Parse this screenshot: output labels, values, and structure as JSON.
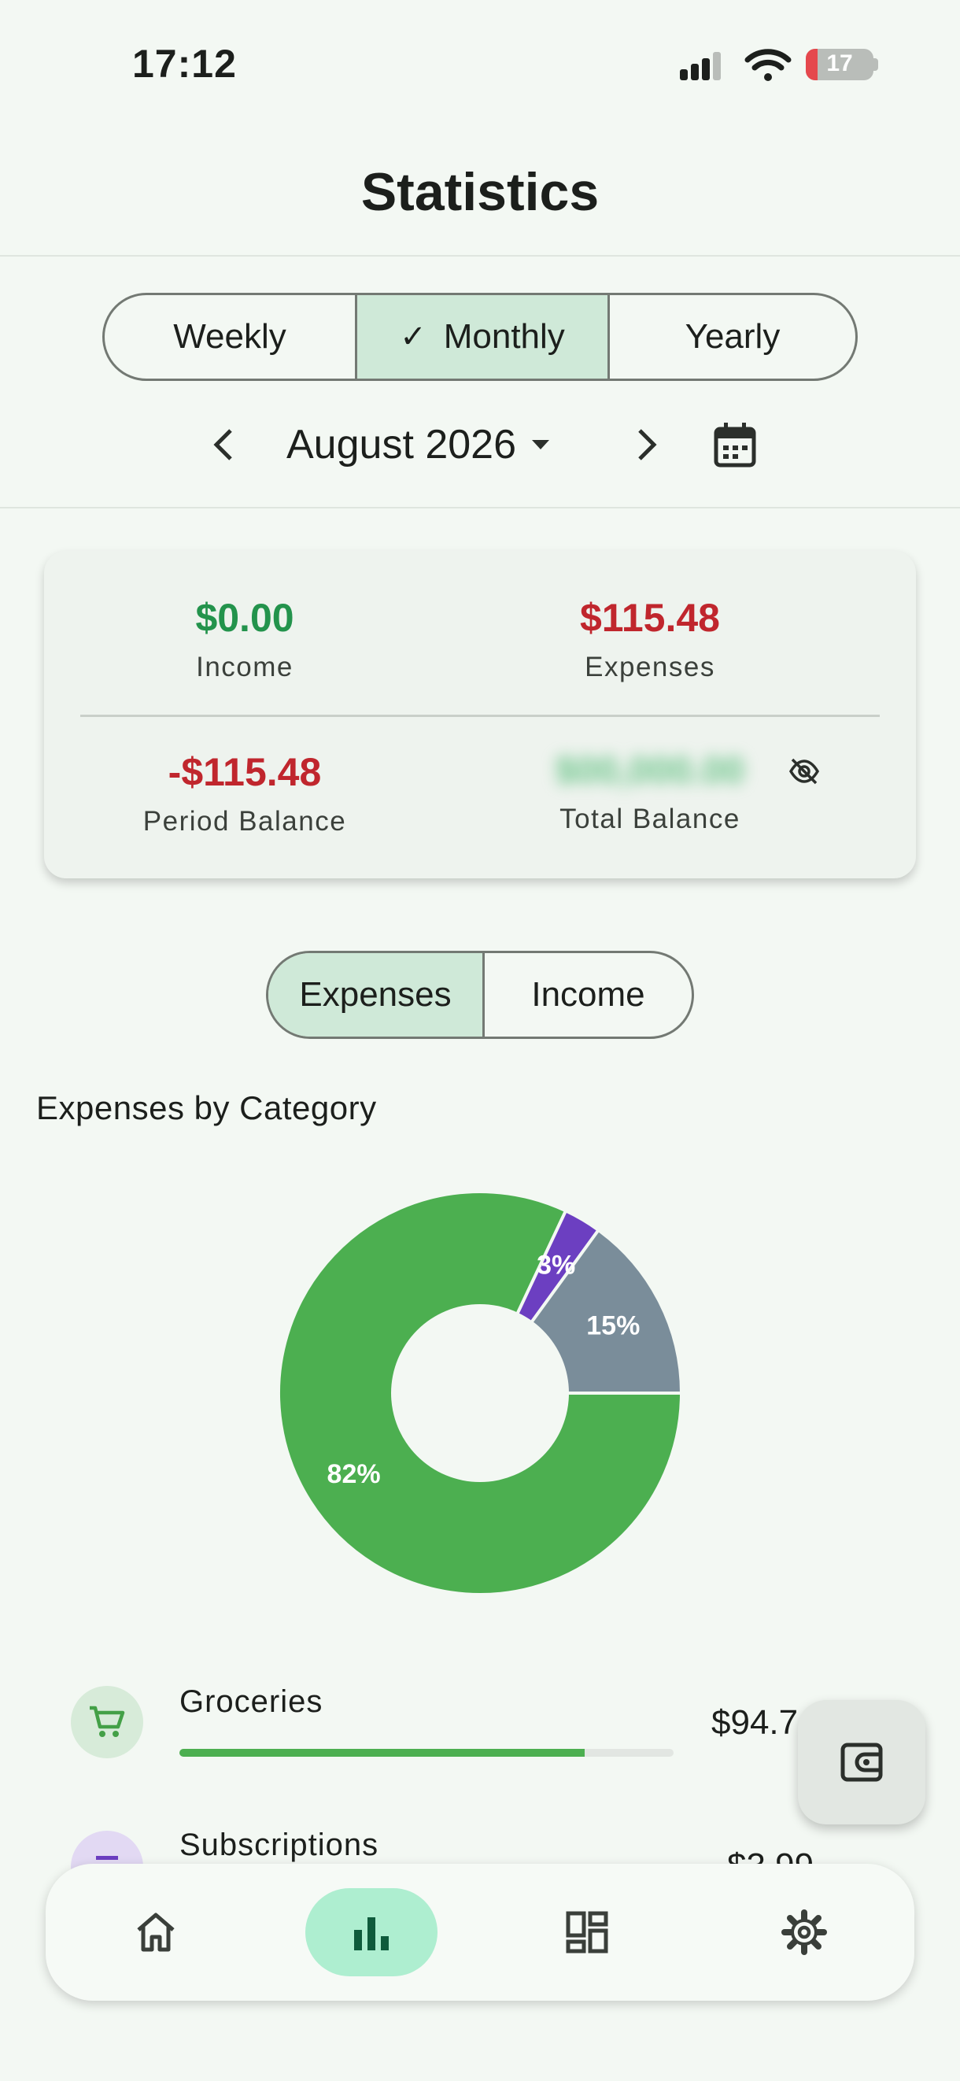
{
  "status_bar": {
    "time": "17:12",
    "battery": "17"
  },
  "header": {
    "title": "Statistics"
  },
  "period_tabs": [
    {
      "label": "Weekly",
      "selected": false
    },
    {
      "label": "Monthly",
      "selected": true
    },
    {
      "label": "Yearly",
      "selected": false
    }
  ],
  "period": {
    "label": "August 2026"
  },
  "summary": {
    "income": {
      "value": "$0.00",
      "label": "Income"
    },
    "expenses": {
      "value": "$115.48",
      "label": "Expenses"
    },
    "period_balance": {
      "value": "-$115.48",
      "label": "Period Balance"
    },
    "total_balance": {
      "value": "$00,000.00",
      "label": "Total Balance"
    }
  },
  "type_tabs": [
    {
      "label": "Expenses",
      "selected": true
    },
    {
      "label": "Income",
      "selected": false
    }
  ],
  "section_title": "Expenses by Category",
  "chart_data": {
    "type": "pie",
    "slices": [
      {
        "label": "82%",
        "value": 82,
        "color": "#4caf50"
      },
      {
        "label": "3%",
        "value": 3,
        "color": "#6c3fc1"
      },
      {
        "label": "15%",
        "value": 15,
        "color": "#7a8d9a"
      }
    ]
  },
  "categories": [
    {
      "name": "Groceries",
      "amount": "$94.7",
      "progress": 0.82,
      "icon": "cart-icon"
    },
    {
      "name": "Subscriptions",
      "amount": "$3.99",
      "progress": 0.03,
      "icon": "subscriptions-icon"
    }
  ],
  "colors": {
    "accent_green": "#4caf50",
    "expense_red": "#c0262d",
    "income_green": "#23934c",
    "nav_active": "#aeeed0"
  }
}
